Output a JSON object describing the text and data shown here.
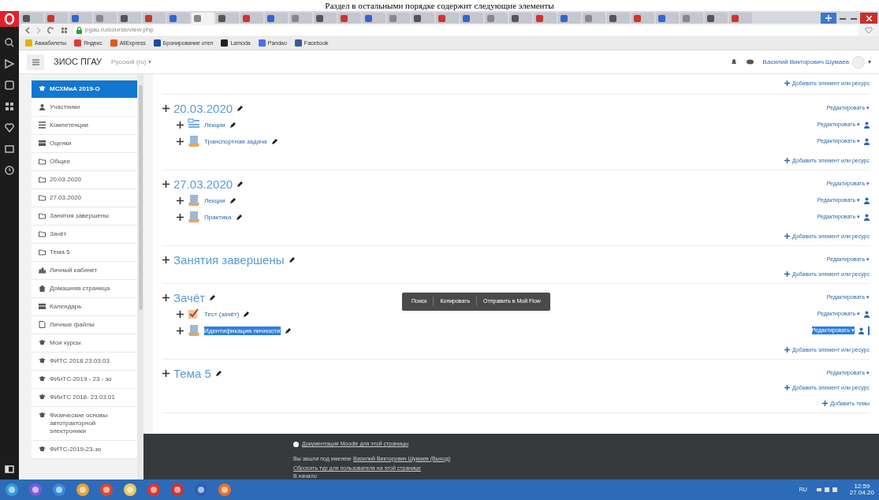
{
  "document_caption": "Раздел в остальными порядке содержит следующие элементы",
  "browser": {
    "tabs": [
      {
        "selected": false
      },
      {
        "selected": false
      },
      {
        "selected": false
      },
      {
        "selected": false
      },
      {
        "selected": false
      },
      {
        "selected": false
      },
      {
        "selected": false
      },
      {
        "selected": true
      },
      {
        "selected": false
      },
      {
        "selected": false
      },
      {
        "selected": false
      },
      {
        "selected": false
      },
      {
        "selected": false
      },
      {
        "selected": false
      },
      {
        "selected": false
      },
      {
        "selected": false
      },
      {
        "selected": false
      },
      {
        "selected": false
      },
      {
        "selected": false
      },
      {
        "selected": false
      },
      {
        "selected": false
      },
      {
        "selected": false
      },
      {
        "selected": false
      },
      {
        "selected": false
      },
      {
        "selected": false
      },
      {
        "selected": false
      },
      {
        "selected": false
      },
      {
        "selected": false
      },
      {
        "selected": false
      },
      {
        "selected": false
      }
    ],
    "url": "pgau.ru/course/view.php",
    "bookmarks": [
      {
        "label": "Авиабилеты",
        "color": "#e8b000"
      },
      {
        "label": "Яндекс",
        "color": "#e53935"
      },
      {
        "label": "AliExpress",
        "color": "#e8541c"
      },
      {
        "label": "Бронирование отел",
        "color": "#1e4aa8"
      },
      {
        "label": "Lamoda",
        "color": "#222222"
      },
      {
        "label": "Pandao",
        "color": "#4a6cf0"
      },
      {
        "label": "Facebook",
        "color": "#3b5998"
      }
    ]
  },
  "navbar": {
    "site": "ЗИОС ПГАУ",
    "language": "Русский (ru) ▾",
    "user": "Василий Викторович Шумаев",
    "user_caret": "▾"
  },
  "nav_drawer": [
    {
      "label": "МСХМиА 2019-О",
      "kind": "course",
      "selected": true
    },
    {
      "label": "Участники",
      "kind": "users",
      "selected": false
    },
    {
      "label": "Компетенции",
      "kind": "list",
      "selected": false
    },
    {
      "label": "Оценки",
      "kind": "table",
      "selected": false
    },
    {
      "label": "Общее",
      "kind": "folder",
      "selected": false
    },
    {
      "label": "20.03.2020",
      "kind": "folder",
      "selected": false
    },
    {
      "label": "27.03.2020",
      "kind": "folder",
      "selected": false
    },
    {
      "label": "Занятия завершены",
      "kind": "folder",
      "selected": false
    },
    {
      "label": "Зачёт",
      "kind": "folder",
      "selected": false
    },
    {
      "label": "Тема 5",
      "kind": "folder",
      "selected": false
    },
    {
      "label": "Личный кабинет",
      "kind": "dashboard",
      "selected": false
    },
    {
      "label": "Домашняя страница",
      "kind": "home",
      "selected": false
    },
    {
      "label": "Календарь",
      "kind": "table",
      "selected": false
    },
    {
      "label": "Личные файлы",
      "kind": "file",
      "selected": false
    },
    {
      "label": "Мои курсы",
      "kind": "course",
      "selected": false
    },
    {
      "label": "ФИТС 2018 23.03.03",
      "kind": "course",
      "selected": false
    },
    {
      "label": "ФИиТС-2019 - 23 - зо",
      "kind": "course",
      "selected": false
    },
    {
      "label": "ФИиТС 2018- 23.03.01",
      "kind": "course",
      "selected": false
    },
    {
      "label": "Физические основы автотракторной электроники",
      "kind": "course",
      "selected": false
    },
    {
      "label": "ФИТС-2019-23-зо",
      "kind": "course",
      "selected": false
    }
  ],
  "top_add": "Добавить элемент или ресурс",
  "sections": [
    {
      "title": "20.03.2020",
      "edit": "Редактировать ▾",
      "add": "Добавить элемент или ресурс",
      "activities": [
        {
          "name": "Лекции",
          "kind": "page",
          "edit": "Редактировать ▾",
          "selected": false
        },
        {
          "name": "Транспортная задача",
          "kind": "resource",
          "edit": "Редактировать ▾",
          "selected": false
        }
      ]
    },
    {
      "title": "27.03.2020",
      "edit": "Редактировать ▾",
      "add": "Добавить элемент или ресурс",
      "activities": [
        {
          "name": "Лекции",
          "kind": "resource",
          "edit": "Редактировать ▾",
          "selected": false
        },
        {
          "name": "Практика",
          "kind": "resource",
          "edit": "Редактировать ▾",
          "selected": false
        }
      ]
    },
    {
      "title": "Занятия завершены",
      "edit": "Редактировать ▾",
      "add": "Добавить элемент или ресурс"
    },
    {
      "title": "Зачёт",
      "edit": "Редактировать ▾",
      "add": "Добавить элемент или ресурс",
      "activities": [
        {
          "name": "Тест (зачёт)",
          "kind": "quiz",
          "edit": "Редактировать ▾",
          "selected": false
        },
        {
          "name": "Идентификация личности",
          "kind": "resource",
          "edit": "Редактировать ▾",
          "selected": true
        }
      ]
    },
    {
      "title": "Тема 5",
      "edit": "Редактировать ▾",
      "add": "Добавить элемент или ресурс"
    }
  ],
  "add_sections": "Добавить темы",
  "context_menu": [
    "Поиск",
    "Копировать",
    "Отправить в Мой Flow"
  ],
  "footer": {
    "docs_link": "Документация Moodle для этой страницы",
    "logged_in": "Вы зашли под именем",
    "user_link": "Василий Викторович Шумаев (Выход)",
    "reset_tour": "Сбросить тур для пользователя на этой странице",
    "home": "В начало"
  },
  "taskbar": {
    "language": "RU",
    "time": "12:59",
    "date": "27.04.20"
  }
}
